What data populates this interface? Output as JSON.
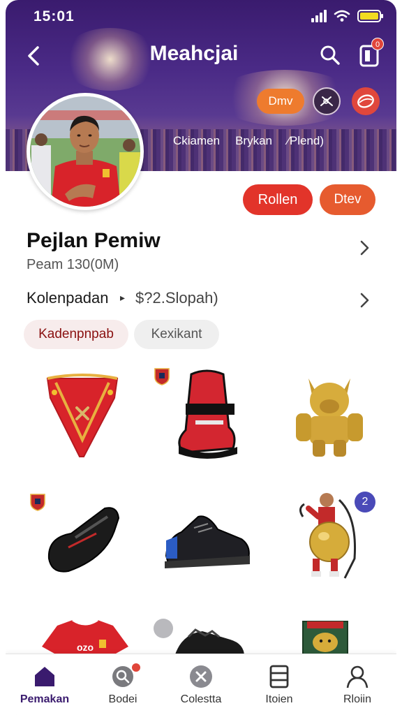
{
  "status_bar": {
    "time": "15:01"
  },
  "header": {
    "title": "Meahcjai",
    "cart_badge": "0",
    "pill_label": "Dmv",
    "stats": [
      "Ckiamen",
      "Brykan",
      "⁄Plend)"
    ]
  },
  "profile": {
    "follow_label": "Rollen",
    "more_label": "Dtev",
    "name": "Pejlan Pemiw",
    "subtitle": "Peam 130(0M)",
    "info_label": "Kolenpadan",
    "info_value": "$?2.Slopah)",
    "chips": [
      "Kadenpnpab",
      "Kexikant"
    ]
  },
  "products": {
    "items": [
      "red-harness",
      "red-black-boot",
      "gold-lion-figurine",
      "black-slide-sandal",
      "black-sneaker",
      "gold-ball-figurine",
      "red-jersey",
      "black-shoe",
      "boxed-figurine"
    ],
    "jersey_text": "ozo",
    "count_badge": "2"
  },
  "bottom_nav": {
    "items": [
      {
        "label": "Pemakan",
        "icon": "home-icon",
        "active": true
      },
      {
        "label": "Bodei",
        "icon": "search-icon",
        "active": false
      },
      {
        "label": "Colestta",
        "icon": "close-circle-icon",
        "active": false
      },
      {
        "label": "Itoien",
        "icon": "list-icon",
        "active": false
      },
      {
        "label": "Rloiin",
        "icon": "user-icon",
        "active": false
      }
    ]
  },
  "colors": {
    "header_bg": "#4a2a86",
    "accent_red": "#e2342a",
    "accent_orange": "#ee7b2e",
    "nav_active": "#3a1b6e",
    "battery": "#f2dc20"
  }
}
